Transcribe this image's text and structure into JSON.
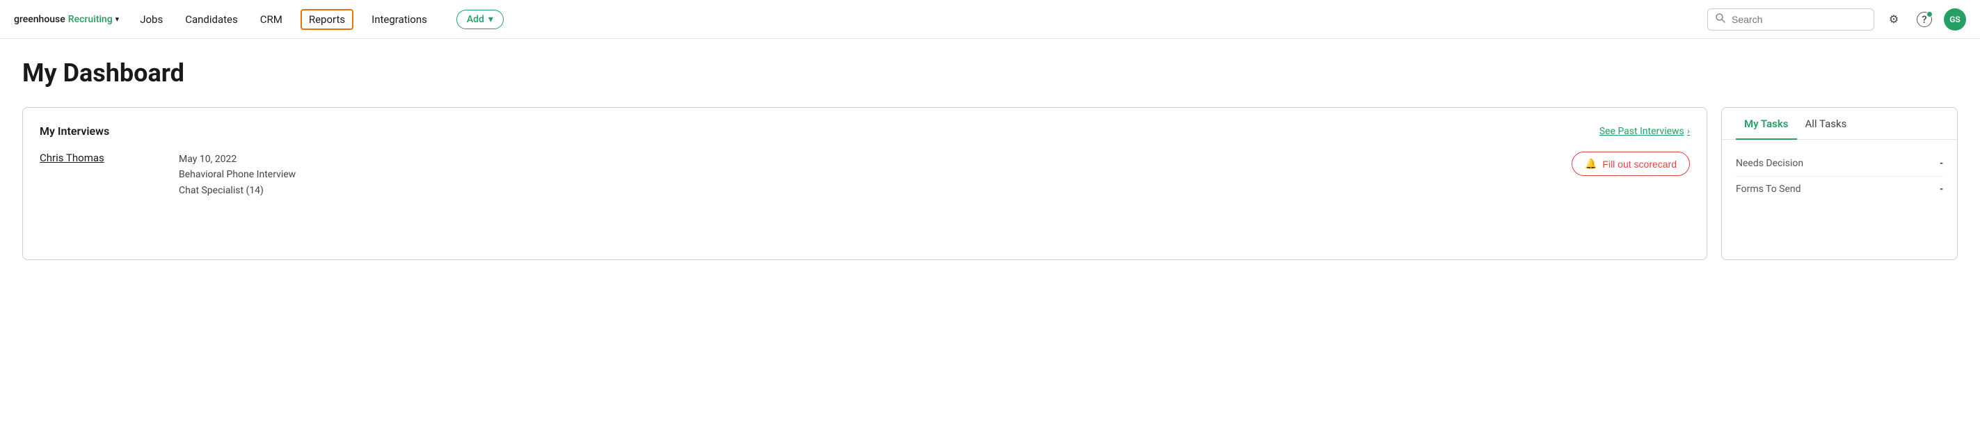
{
  "brand": {
    "greenhouse": "greenhouse",
    "recruiting": "Recruiting",
    "chevron": "▾"
  },
  "nav": {
    "items": [
      {
        "label": "Jobs",
        "active": false
      },
      {
        "label": "Candidates",
        "active": false
      },
      {
        "label": "CRM",
        "active": false
      },
      {
        "label": "Reports",
        "active": true
      },
      {
        "label": "Integrations",
        "active": false
      }
    ],
    "add_label": "Add",
    "add_chevron": "▾"
  },
  "search": {
    "placeholder": "Search"
  },
  "icons": {
    "gear": "⚙",
    "help": "?",
    "avatar": "GS",
    "bell": "🔔",
    "search": "🔍"
  },
  "page": {
    "title": "My Dashboard"
  },
  "interviews_card": {
    "title": "My Interviews",
    "see_past_label": "See Past Interviews",
    "chevron": "›",
    "candidate_name": "Chris Thomas",
    "interview_date": "May 10, 2022",
    "interview_type": "Behavioral Phone Interview",
    "interview_role": "Chat Specialist (14)",
    "scorecard_bell": "🔔",
    "scorecard_label": "Fill out scorecard"
  },
  "tasks_card": {
    "tab_my": "My Tasks",
    "tab_all": "All Tasks",
    "tasks": [
      {
        "label": "Needs Decision",
        "count": "-"
      },
      {
        "label": "Forms To Send",
        "count": "-"
      }
    ]
  }
}
